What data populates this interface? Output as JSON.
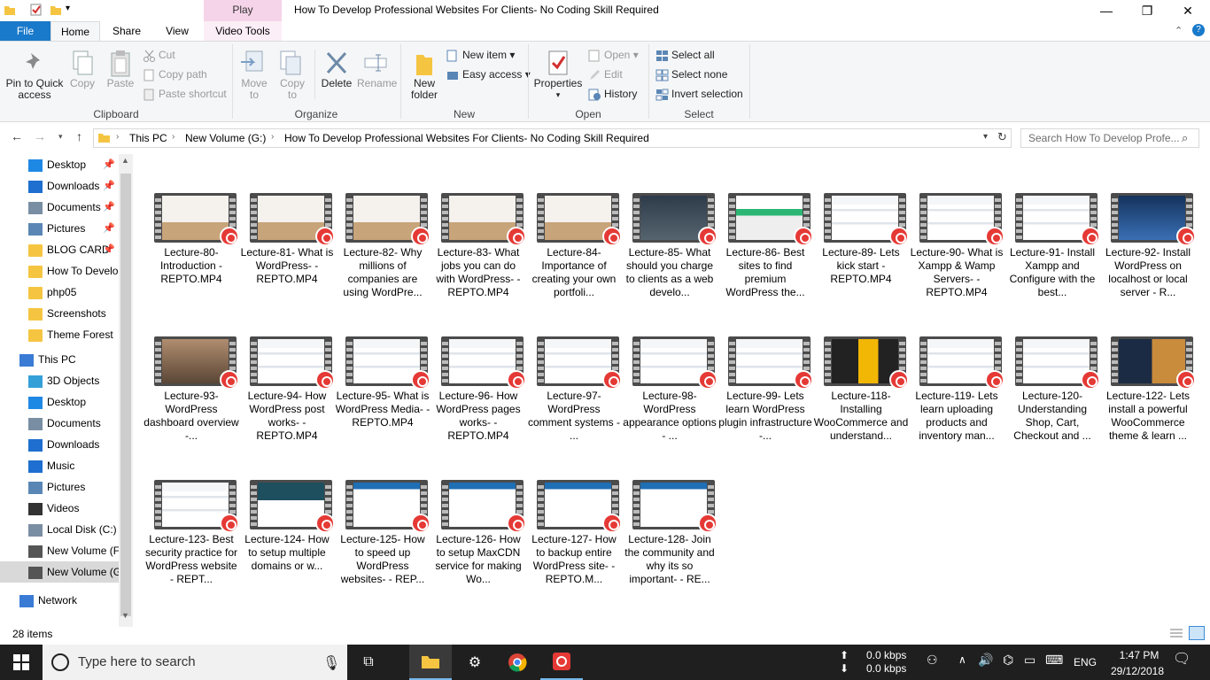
{
  "window": {
    "title": "How To Develop Professional Websites For Clients- No Coding Skill Required",
    "context_tab": "Play"
  },
  "tabs": [
    "File",
    "Home",
    "Share",
    "View",
    "Video Tools"
  ],
  "ribbon": {
    "clipboard": {
      "pin": "Pin to Quick access",
      "copy": "Copy",
      "paste": "Paste",
      "cut": "Cut",
      "copy_path": "Copy path",
      "paste_shortcut": "Paste shortcut",
      "label": "Clipboard"
    },
    "organize": {
      "move_to": "Move to",
      "copy_to": "Copy to",
      "delete": "Delete",
      "rename": "Rename",
      "label": "Organize"
    },
    "new": {
      "new_folder": "New folder",
      "new_item": "New item",
      "easy_access": "Easy access",
      "label": "New"
    },
    "open": {
      "properties": "Properties",
      "open": "Open",
      "edit": "Edit",
      "history": "History",
      "label": "Open"
    },
    "select": {
      "select_all": "Select all",
      "select_none": "Select none",
      "invert": "Invert selection",
      "label": "Select"
    }
  },
  "address": {
    "crumbs": [
      "This PC",
      "New Volume (G:)",
      "How To Develop Professional Websites For Clients- No Coding Skill Required"
    ],
    "search_placeholder": "Search How To Develop Profe..."
  },
  "nav": {
    "quick": [
      {
        "label": "Desktop",
        "pinned": true,
        "icon": "desktop-icon",
        "color": "#1e88e5"
      },
      {
        "label": "Downloads",
        "pinned": true,
        "icon": "download-icon",
        "color": "#1e6fd0"
      },
      {
        "label": "Documents",
        "pinned": true,
        "icon": "document-icon",
        "color": "#7a8ea3"
      },
      {
        "label": "Pictures",
        "pinned": true,
        "icon": "pictures-icon",
        "color": "#5a86b5"
      },
      {
        "label": "BLOG CARD",
        "pinned": true,
        "icon": "folder-icon",
        "color": "#f5c542"
      },
      {
        "label": "How To Develo",
        "pinned": false,
        "icon": "folder-icon",
        "color": "#f5c542"
      },
      {
        "label": "php05",
        "pinned": false,
        "icon": "folder-icon",
        "color": "#f5c542"
      },
      {
        "label": "Screenshots",
        "pinned": false,
        "icon": "folder-icon",
        "color": "#f5c542"
      },
      {
        "label": "Theme Forest",
        "pinned": false,
        "icon": "folder-icon",
        "color": "#f5c542"
      }
    ],
    "this_pc": "This PC",
    "pc_items": [
      {
        "label": "3D Objects",
        "icon": "cube-icon",
        "color": "#35a0d8"
      },
      {
        "label": "Desktop",
        "icon": "desktop-icon",
        "color": "#1e88e5"
      },
      {
        "label": "Documents",
        "icon": "document-icon",
        "color": "#7a8ea3"
      },
      {
        "label": "Downloads",
        "icon": "download-icon",
        "color": "#1e6fd0"
      },
      {
        "label": "Music",
        "icon": "music-icon",
        "color": "#1e6fd0"
      },
      {
        "label": "Pictures",
        "icon": "pictures-icon",
        "color": "#5a86b5"
      },
      {
        "label": "Videos",
        "icon": "video-icon",
        "color": "#333"
      },
      {
        "label": "Local Disk (C:)",
        "icon": "drive-icon",
        "color": "#7a8ea3"
      },
      {
        "label": "New Volume (F",
        "icon": "drive-icon",
        "color": "#555"
      },
      {
        "label": "New Volume (G",
        "icon": "drive-icon",
        "color": "#555",
        "selected": true
      }
    ],
    "network": "Network"
  },
  "files": [
    {
      "name": "Lecture-80- Introduction - REPTO.MP4",
      "thumb": "person"
    },
    {
      "name": "Lecture-81- What is WordPress- - REPTO.MP4",
      "thumb": "person"
    },
    {
      "name": "Lecture-82- Why millions of companies are using WordPre...",
      "thumb": "person"
    },
    {
      "name": "Lecture-83- What jobs you can do with WordPress- - REPTO.MP4",
      "thumb": "person"
    },
    {
      "name": "Lecture-84- Importance of creating your own portfoli...",
      "thumb": "person"
    },
    {
      "name": "Lecture-85- What should you charge to clients as a web develo...",
      "thumb": "dark"
    },
    {
      "name": "Lecture-86- Best sites to find premium WordPress the...",
      "thumb": "green"
    },
    {
      "name": "Lecture-89- Lets kick start - REPTO.MP4",
      "thumb": "web"
    },
    {
      "name": "Lecture-90- What is Xampp & Wamp Servers- - REPTO.MP4",
      "thumb": "web"
    },
    {
      "name": "Lecture-91- Install Xampp and Configure with the best...",
      "thumb": "web"
    },
    {
      "name": "Lecture-92- Install WordPress on localhost or local server - R...",
      "thumb": "blue"
    },
    {
      "name": "Lecture-93- WordPress dashboard overview -...",
      "thumb": "photo"
    },
    {
      "name": "Lecture-94- How WordPress post works- - REPTO.MP4",
      "thumb": "web"
    },
    {
      "name": "Lecture-95- What is WordPress Media- - REPTO.MP4",
      "thumb": "web"
    },
    {
      "name": "Lecture-96- How WordPress pages works- - REPTO.MP4",
      "thumb": "web"
    },
    {
      "name": "Lecture-97- WordPress comment systems - ...",
      "thumb": "web"
    },
    {
      "name": "Lecture-98- WordPress appearance options - ...",
      "thumb": "web"
    },
    {
      "name": "Lecture-99- Lets learn WordPress plugin infrastructure -...",
      "thumb": "web"
    },
    {
      "name": "Lecture-118- Installing WooCommerce and understand...",
      "thumb": "yellow"
    },
    {
      "name": "Lecture-119- Lets learn uploading products and inventory man...",
      "thumb": "web"
    },
    {
      "name": "Lecture-120- Understanding Shop, Cart, Checkout and ...",
      "thumb": "web"
    },
    {
      "name": "Lecture-122- Lets install a powerful WooCommerce theme & learn ...",
      "thumb": "navy"
    },
    {
      "name": "Lecture-123- Best security practice for WordPress website - REPT...",
      "thumb": "web"
    },
    {
      "name": "Lecture-124- How to setup multiple domains or w...",
      "thumb": "teal"
    },
    {
      "name": "Lecture-125- How to speed up WordPress websites- - REP...",
      "thumb": "perf"
    },
    {
      "name": "Lecture-126- How to setup MaxCDN service for making Wo...",
      "thumb": "perf"
    },
    {
      "name": "Lecture-127- How to backup entire WordPress site- - REPTO.M...",
      "thumb": "perf"
    },
    {
      "name": "Lecture-128- Join the community and why its so important- - RE...",
      "thumb": "perf"
    }
  ],
  "status": {
    "item_count": "28 items"
  },
  "taskbar": {
    "search_placeholder": "Type here to search",
    "net_up": "0.0 kbps",
    "net_down": "0.0 kbps",
    "lang": "ENG",
    "time": "1:47 PM",
    "date": "29/12/2018"
  }
}
